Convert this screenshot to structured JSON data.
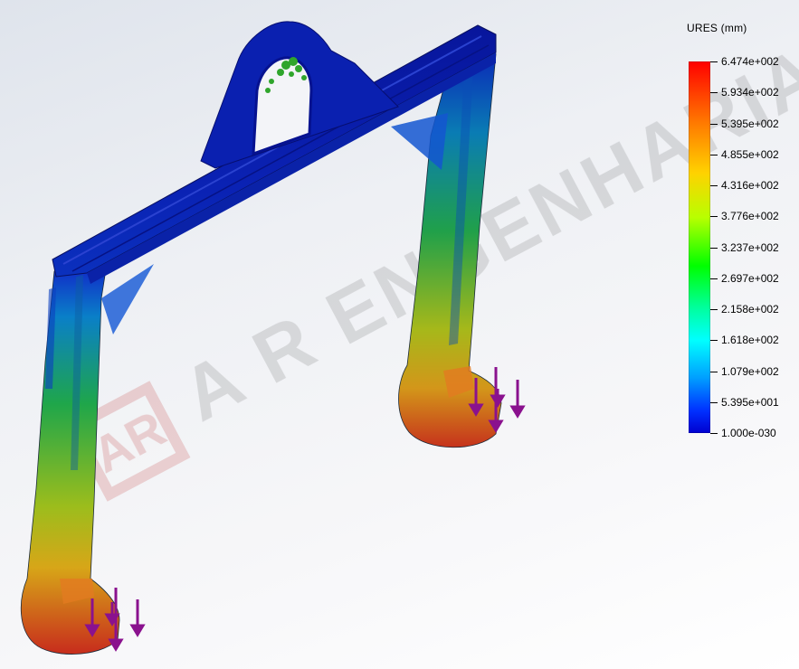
{
  "legend": {
    "title": "URES (mm)",
    "values": [
      "6.474e+002",
      "5.934e+002",
      "5.395e+002",
      "4.855e+002",
      "4.316e+002",
      "3.776e+002",
      "3.237e+002",
      "2.697e+002",
      "2.158e+002",
      "1.618e+002",
      "1.079e+002",
      "5.395e+001",
      "1.000e-030"
    ]
  },
  "watermark": {
    "text": "A R ENGENHARIA",
    "logo_letters": "AR"
  },
  "colors": {
    "blue": "#0a1eb4",
    "green": "#2fb832",
    "yellow": "#e3d21a",
    "red": "#c9321c",
    "arrow": "#8a118e"
  }
}
